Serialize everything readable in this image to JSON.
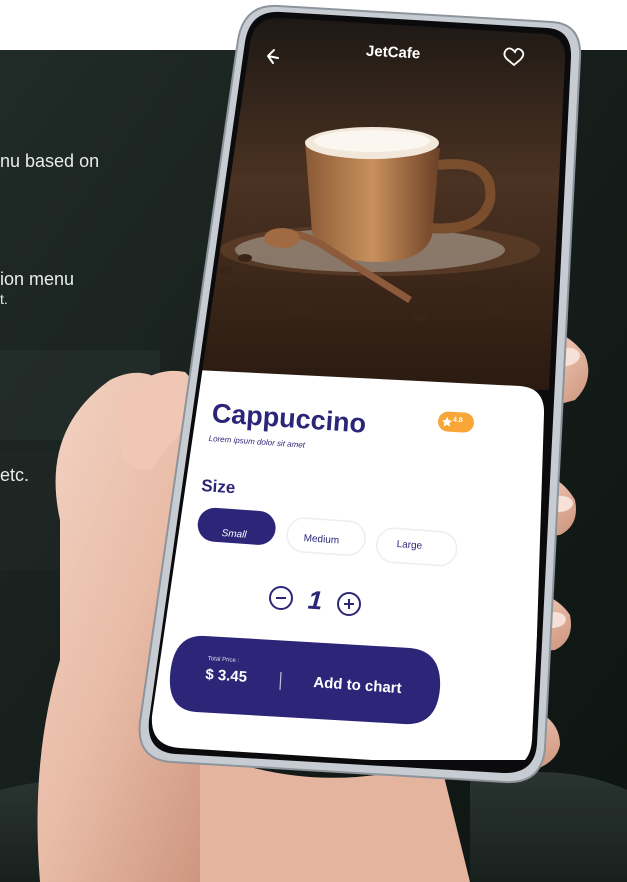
{
  "header": {
    "title": "JetCafe",
    "back_icon": "arrow-left-icon",
    "favorite_icon": "heart-outline-icon"
  },
  "product": {
    "name": "Cappuccino",
    "description": "Lorem ipsum dolor sit amet",
    "rating": "4.8",
    "rating_icon": "star-icon"
  },
  "size": {
    "label": "Size",
    "options": [
      "Small",
      "Medium",
      "Large"
    ],
    "selected": "Small"
  },
  "quantity": {
    "value": "1",
    "minus_icon": "minus-circle-icon",
    "plus_icon": "plus-circle-icon"
  },
  "checkout": {
    "total_label": "Total Price :",
    "total_value": "$ 3.45",
    "button_label": "Add to chart"
  },
  "background_text": {
    "line1": "nu based on",
    "line2": "ion menu",
    "line2_tail": "t.",
    "line3": "etc."
  },
  "colors": {
    "primary": "#2c2578",
    "rating_badge": "#f7a637",
    "card": "#ffffff",
    "background_dark": "#1a2320"
  }
}
